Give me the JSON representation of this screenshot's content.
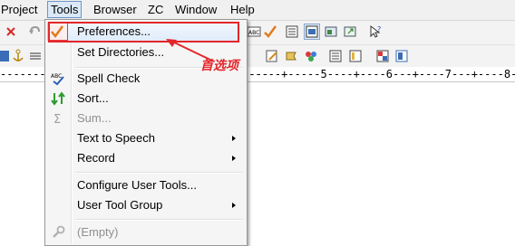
{
  "menubar": {
    "items": [
      {
        "label": "Project"
      },
      {
        "label": "Tools"
      },
      {
        "label": "Browser"
      },
      {
        "label": "ZC"
      },
      {
        "label": "Window"
      },
      {
        "label": "Help"
      }
    ]
  },
  "ruler": {
    "marks": [
      "5",
      "6",
      "7",
      "8"
    ]
  },
  "tools_menu": {
    "items": [
      {
        "label": "Preferences...",
        "icon": "checkmark-icon",
        "checked": true
      },
      {
        "label": "Set Directories...",
        "icon": ""
      },
      {
        "label": "Spell Check",
        "icon": "spell-check-icon"
      },
      {
        "label": "Sort...",
        "icon": "sort-icon"
      },
      {
        "label": "Sum...",
        "icon": "sigma-icon",
        "disabled": true
      },
      {
        "label": "Text to Speech",
        "submenu": true
      },
      {
        "label": "Record",
        "submenu": true
      },
      {
        "label": "Configure User Tools..."
      },
      {
        "label": "User Tool Group",
        "submenu": true
      },
      {
        "label": "(Empty)",
        "icon": "wrench-icon",
        "disabled": true
      }
    ]
  },
  "annotation": {
    "text": "首选项",
    "color": "#e3262a"
  },
  "colors": {
    "highlight_border": "#aecdf0",
    "annotation_red": "#e3262a",
    "menu_bg": "#f5f5f5"
  }
}
